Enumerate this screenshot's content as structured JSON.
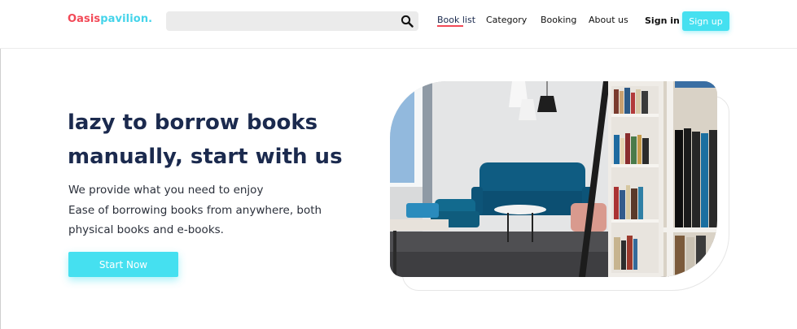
{
  "brand": {
    "part1": "Oasis",
    "part2": "pavilion."
  },
  "search": {
    "value": "",
    "placeholder": ""
  },
  "nav": {
    "book_list": "Book list",
    "category": "Category",
    "booking": "Booking",
    "about": "About us"
  },
  "auth": {
    "sign_in": "Sign in",
    "sign_up": "Sign up"
  },
  "hero": {
    "title_line1": "lazy to borrow books",
    "title_line2": "manually, start with us",
    "sub_line1": "We provide what you need to enjoy",
    "sub_line2": "Ease of borrowing books from anywhere, both",
    "sub_line3": "physical books and e-books.",
    "cta": "Start Now"
  },
  "colors": {
    "brand_red": "#f24957",
    "accent_cyan": "#45e0f0",
    "heading": "#1b2a4e"
  }
}
